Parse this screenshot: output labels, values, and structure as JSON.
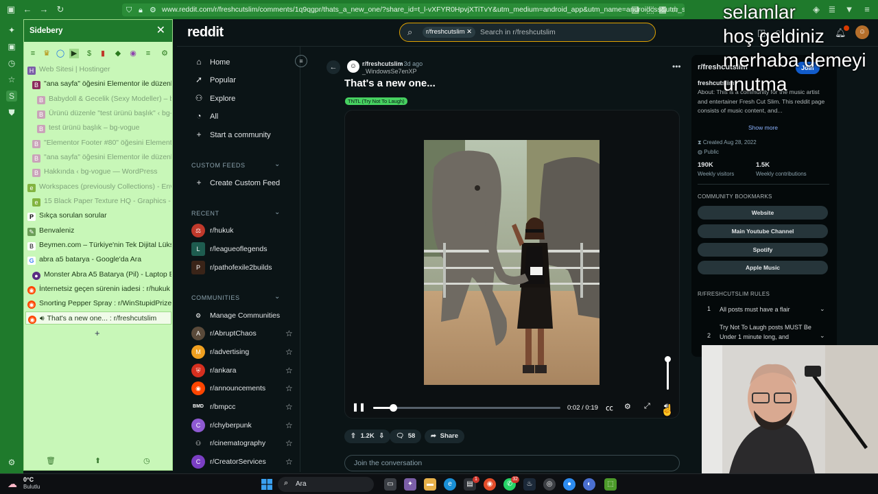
{
  "browser": {
    "url": "www.reddit.com/r/freshcutslim/comments/1q9qgpr/thats_a_new_one/?share_id=t_l-vXFYR0HpvjXTiTvY&utm_medium=android_app&utm_name=androidcss&utm_sc"
  },
  "sidebery": {
    "title": "Sidebery",
    "items": [
      {
        "label": "Web Sitesi | Hostinger",
        "dim": true
      },
      {
        "label": "\"ana sayfa\" öğesini Elementor ile düzenley",
        "dim": false
      },
      {
        "label": "Babydoll & Gecelik (Sexy Modeller) – bg",
        "dim": true
      },
      {
        "label": "Ürünü düzenle \"test ürünü başlık\" ‹ bg-v",
        "dim": true
      },
      {
        "label": "test ürünü başlık – bg-vogue",
        "dim": true
      },
      {
        "label": "\"Elementor Footer #80\" öğesini Elementor",
        "dim": true
      },
      {
        "label": "\"ana sayfa\" öğesini Elementor ile düzenley",
        "dim": true
      },
      {
        "label": "Hakkında ‹ bg-vogue — WordPress",
        "dim": true
      },
      {
        "label": "Workspaces (previously Collections) - Envat",
        "dim": true
      },
      {
        "label": "15 Black Paper Texture HQ - Graphics - Env",
        "dim": true
      },
      {
        "label": "Sıkça sorulan sorular",
        "dim": false
      },
      {
        "label": "Benvaleniz",
        "dim": false
      },
      {
        "label": "Beymen.com – Türkiye'nin Tek Dijital Lüks Pl",
        "dim": false
      },
      {
        "label": "abra a5 batarya - Google'da Ara",
        "dim": false
      },
      {
        "label": "Monster Abra A5 Batarya (Pil) - Laptop Bat",
        "dim": false
      },
      {
        "label": "İnternetsiz geçen sürenin iadesi : r/hukuk",
        "dim": false
      },
      {
        "label": "Snorting Pepper Spray : r/WinStupidPrizes",
        "dim": false
      },
      {
        "label": "That's a new one... : r/freshcutslim",
        "dim": false
      }
    ]
  },
  "reddit": {
    "logo": "reddit",
    "search": {
      "chip": "r/freshcutslim",
      "placeholder": "Search in r/freshcutslim"
    },
    "nav": [
      "Home",
      "Popular",
      "Explore",
      "All",
      "Start a community"
    ],
    "custom_feeds": {
      "header": "CUSTOM FEEDS",
      "create": "Create Custom Feed"
    },
    "recent": {
      "header": "RECENT",
      "items": [
        "r/hukuk",
        "r/leagueoflegends",
        "r/pathofexile2builds"
      ]
    },
    "communities": {
      "header": "COMMUNITIES",
      "manage": "Manage Communities",
      "items": [
        "r/AbruptChaos",
        "r/advertising",
        "r/ankara",
        "r/announcements",
        "r/bmpcc",
        "r/chyberpunk",
        "r/cinematography",
        "r/CreatorServices"
      ]
    }
  },
  "post": {
    "subreddit": "r/freshcutslim",
    "time": "• 3d ago",
    "user": "_WindowsSe7enXP",
    "title": "That's a new one...",
    "flair": "TNTL (Try Not To Laugh)",
    "video": {
      "current": "0:02",
      "total": "0:19",
      "time_label": "0:02 / 0:19",
      "progress": 0.105,
      "volume": 1.0
    },
    "upvotes": "1.2K",
    "comments": "58",
    "share": "Share",
    "comment_placeholder": "Join the conversation"
  },
  "sidebar": {
    "title": "r/freshcutslim",
    "join": "Join",
    "name": "freshcutslim",
    "about": "About: This is a community for the music artist and entertainer Fresh Cut Slim. This reddit page consists of music content, and...",
    "show_more": "Show more",
    "created": "Created Aug 28, 2022",
    "visibility": "Public",
    "visitors": "190K",
    "visitors_label": "Weekly visitors",
    "contributions": "1.5K",
    "contributions_label": "Weekly contributions",
    "bookmarks_header": "COMMUNITY BOOKMARKS",
    "bookmarks": [
      "Website",
      "Main Youtube Channel",
      "Spotify",
      "Apple Music"
    ],
    "rules_header": "R/FRESHCUTSLIM RULES",
    "rules": [
      {
        "n": "1",
        "text": "All posts must have a flair"
      },
      {
        "n": "2",
        "text": "Try Not To Laugh posts MUST Be Under 1 minute long, and"
      }
    ]
  },
  "overlay_lines": [
    "selamlar",
    "hoş geldiniz",
    "merhaba demeyi",
    "unutma"
  ],
  "taskbar": {
    "temp": "0°C",
    "weather": "Bulutlu",
    "search": "Ara",
    "badges": {
      "brave": "1",
      "whatsapp": "32"
    }
  },
  "colors": {
    "accent": "#e3a400",
    "flair": "#46d160",
    "join": "#115bca",
    "chrome": "#1f7a2c",
    "sidebery": "#c8f7b8"
  }
}
